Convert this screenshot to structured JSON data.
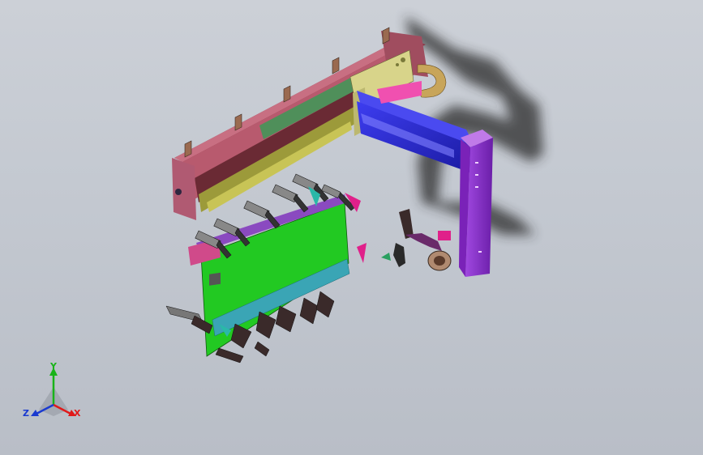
{
  "viewport": {
    "background": "#c6cbd3"
  },
  "model": {
    "colors": {
      "beam_pink": "#b85a6e",
      "beam_dark": "#7a2f3a",
      "rail_green": "#4f8f5a",
      "rail_olive": "#9c9a3a",
      "arm_blue": "#2a2ad0",
      "arm_purple": "#8a2fc9",
      "plate_green": "#22c922",
      "plate_teal": "#3aa5b5",
      "bracket_yellow": "#d8d48a",
      "shadow": "#2a2a2a",
      "magenta": "#e0208a",
      "gripper_dark": "#3a2a2a"
    }
  },
  "triad": {
    "x_label": "X",
    "y_label": "Y",
    "z_label": "Z",
    "x_color": "#e01a1a",
    "y_color": "#19b319",
    "z_color": "#1a3ad0"
  }
}
